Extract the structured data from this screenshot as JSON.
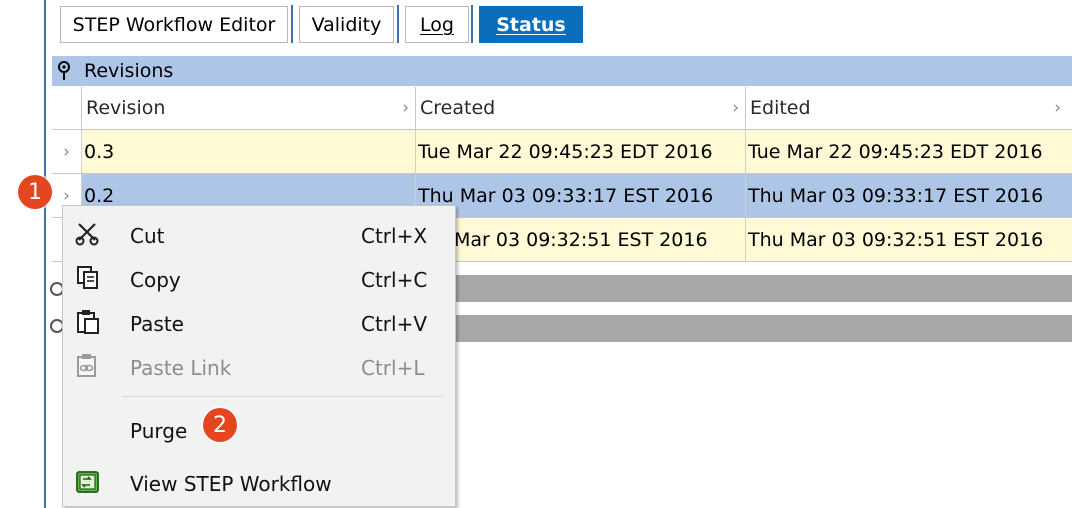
{
  "tabs": [
    {
      "label": "STEP Workflow Editor"
    },
    {
      "label": "Validity"
    },
    {
      "label": "Log"
    },
    {
      "label": "Status",
      "active": true
    }
  ],
  "section": {
    "title": "Revisions",
    "icon": "pin-icon"
  },
  "table": {
    "columns": [
      "Revision",
      "Created",
      "Edited"
    ],
    "rows": [
      {
        "revision": "0.3",
        "created": "Tue Mar 22 09:45:23 EDT 2016",
        "edited": "Tue Mar 22 09:45:23 EDT 2016",
        "selected": false
      },
      {
        "revision": "0.2",
        "created": "Thu Mar 03 09:33:17 EST 2016",
        "edited": "Thu Mar 03 09:33:17 EST 2016",
        "selected": true
      },
      {
        "revision": "",
        "created": "Mar 03 09:32:51 EST 2016",
        "edited": "Thu Mar 03 09:32:51 EST 2016",
        "selected": false
      }
    ]
  },
  "context_menu": {
    "items": [
      {
        "label": "Cut",
        "shortcut": "Ctrl+X",
        "icon": "scissors-icon",
        "enabled": true
      },
      {
        "label": "Copy",
        "shortcut": "Ctrl+C",
        "icon": "copy-icon",
        "enabled": true
      },
      {
        "label": "Paste",
        "shortcut": "Ctrl+V",
        "icon": "paste-icon",
        "enabled": true
      },
      {
        "label": "Paste Link",
        "shortcut": "Ctrl+L",
        "icon": "paste-link-icon",
        "enabled": false
      },
      {
        "label": "Purge",
        "shortcut": "",
        "icon": "",
        "enabled": true
      },
      {
        "label": "View STEP Workflow",
        "shortcut": "",
        "icon": "workflow-icon",
        "enabled": true
      }
    ]
  },
  "callouts": [
    {
      "label": "1",
      "color": "#e6461f"
    },
    {
      "label": "2",
      "color": "#e6461f"
    }
  ]
}
